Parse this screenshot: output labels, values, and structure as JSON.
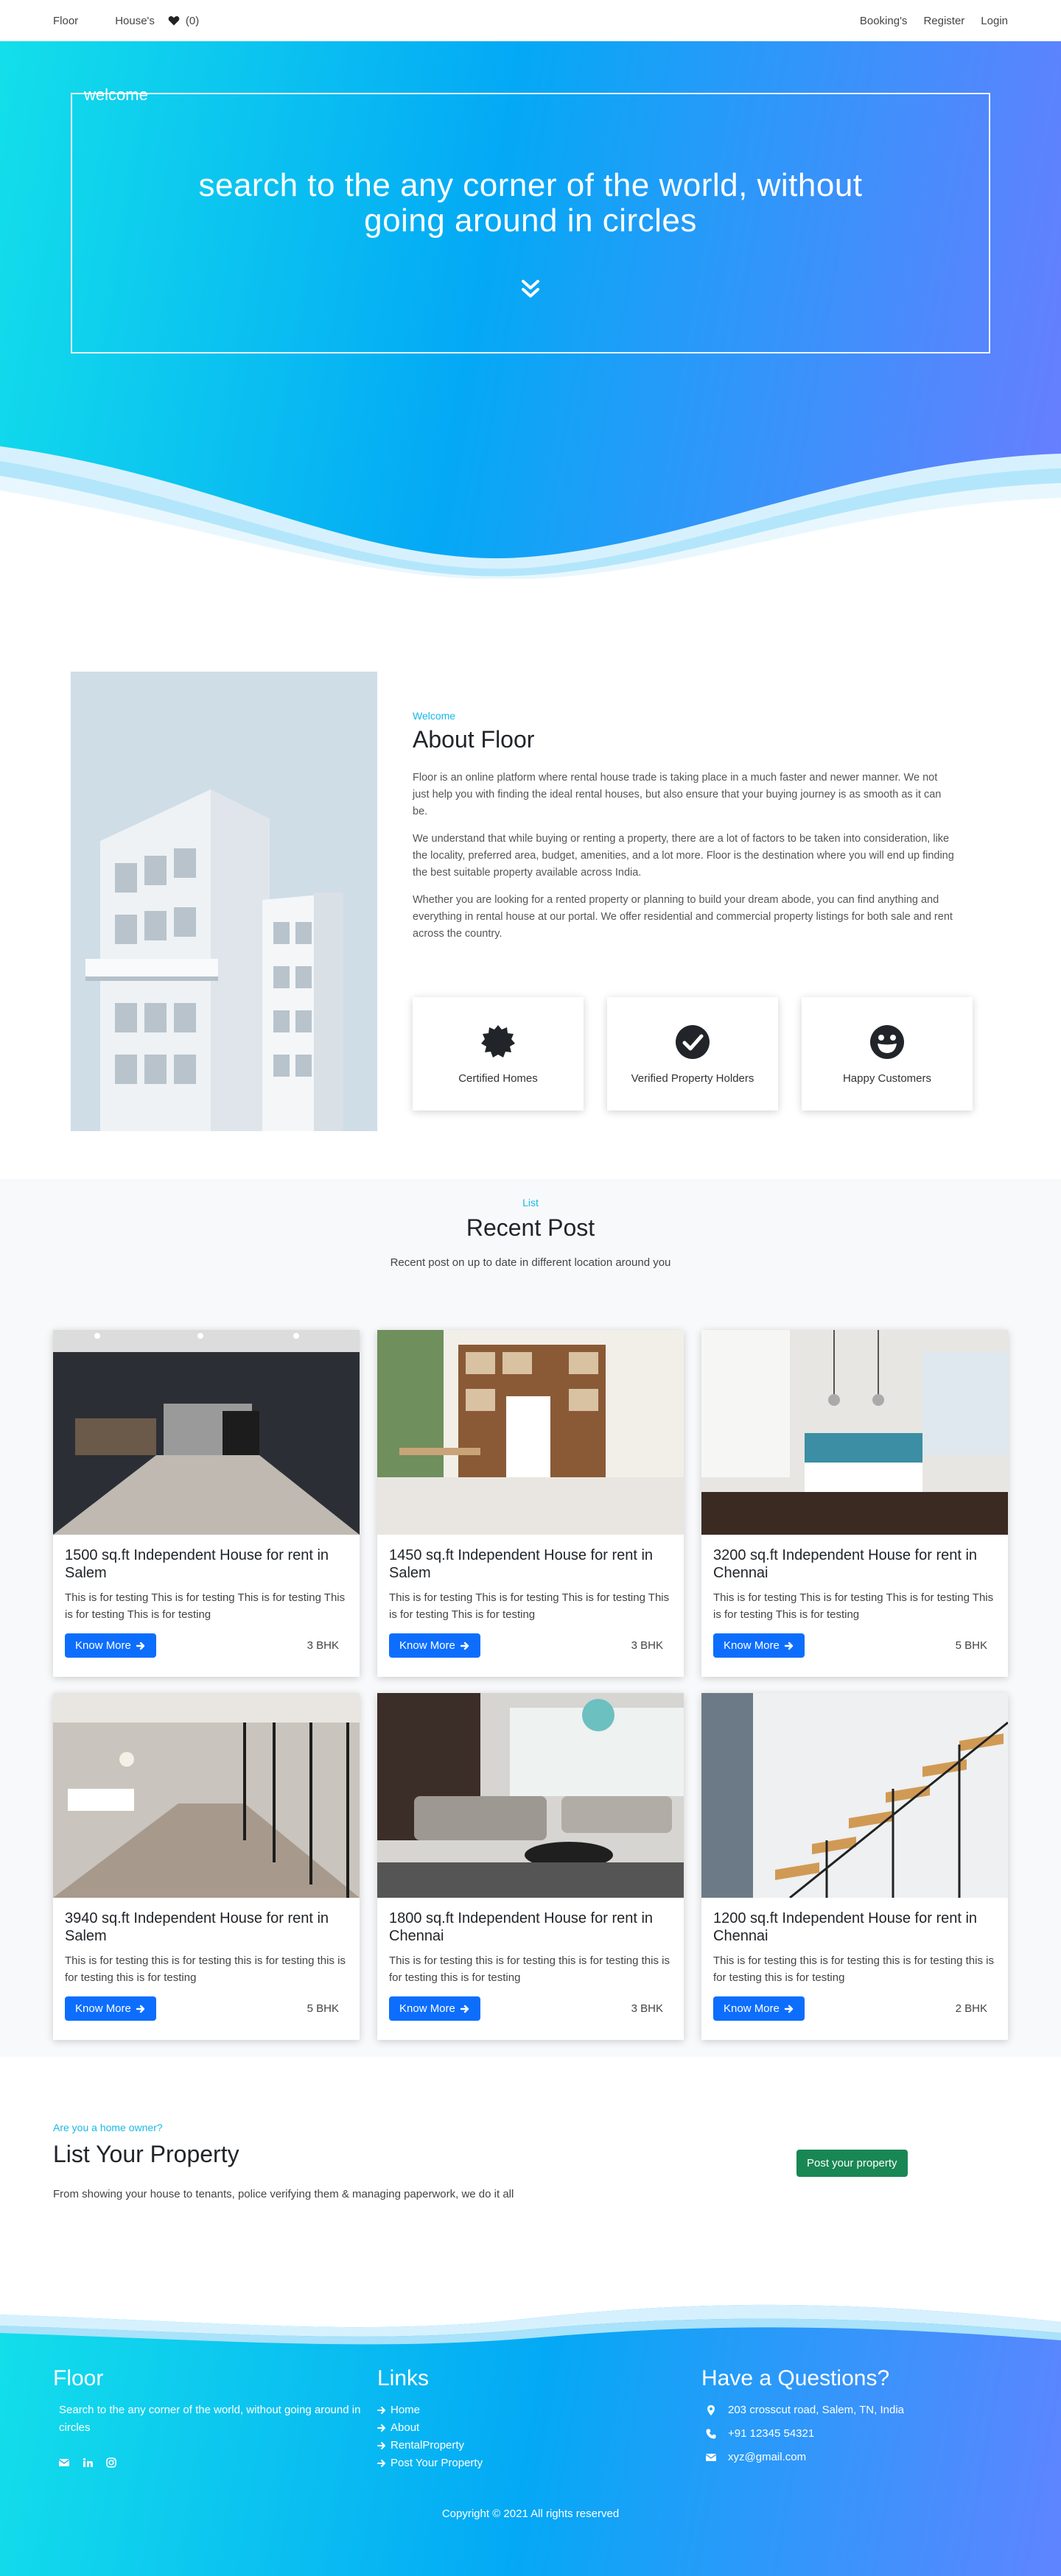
{
  "nav": {
    "brand": "Floor",
    "houses": "House's",
    "fav_count": "(0)",
    "bookings": "Booking's",
    "register": "Register",
    "login": "Login"
  },
  "hero": {
    "legend": "welcome",
    "title": "search to the any corner of the world, without going around in circles"
  },
  "about": {
    "eyebrow": "Welcome",
    "title": "About Floor",
    "p1": "Floor is an online platform where rental house trade is taking place in a much faster and newer manner. We not just help you with finding the ideal rental houses, but also ensure that your buying journey is as smooth as it can be.",
    "p2": "We understand that while buying or renting a property, there are a lot of factors to be taken into consideration, like the locality, preferred area, budget, amenities, and a lot more. Floor is the destination where you will end up finding the best suitable property available across India.",
    "p3": "Whether you are looking for a rented property or planning to build your dream abode, you can find anything and everything in rental house at our portal. We offer residential and commercial property listings for both sale and rent across the country.",
    "features": [
      {
        "label": "Certified Homes",
        "icon": "certificate-icon"
      },
      {
        "label": "Verified Property Holders",
        "icon": "check-circle-icon"
      },
      {
        "label": "Happy Customers",
        "icon": "grin-icon"
      }
    ]
  },
  "recent": {
    "eyebrow": "List",
    "title": "Recent Post",
    "subtitle": "Recent post on up to date in different location around you",
    "button_label": "Know More",
    "cards": [
      {
        "title": "1500 sq.ft Independent House for rent in Salem",
        "text": "This is for testing This is for testing This is for testing This is for testing This is for testing",
        "bhk": "3 BHK"
      },
      {
        "title": "1450 sq.ft Independent House for rent in Salem",
        "text": "This is for testing This is for testing This is for testing This is for testing This is for testing",
        "bhk": "3 BHK"
      },
      {
        "title": "3200 sq.ft Independent House for rent in Chennai",
        "text": "This is for testing This is for testing This is for testing This is for testing This is for testing",
        "bhk": "5 BHK"
      },
      {
        "title": "3940 sq.ft Independent House for rent in Salem",
        "text": "This is for testing this is for testing this is for testing this is for testing this is for testing",
        "bhk": "5 BHK"
      },
      {
        "title": "1800 sq.ft Independent House for rent in Chennai",
        "text": "This is for testing this is for testing this is for testing this is for testing this is for testing",
        "bhk": "3 BHK"
      },
      {
        "title": "1200 sq.ft Independent House for rent in Chennai",
        "text": "This is for testing this is for testing this is for testing this is for testing this is for testing",
        "bhk": "2 BHK"
      }
    ]
  },
  "list_property": {
    "eyebrow": "Are you a home owner?",
    "title": "List Your Property",
    "text": "From showing your house to tenants, police verifying them & managing paperwork, we do it all",
    "button": "Post your property"
  },
  "footer": {
    "brand": "Floor",
    "desc": "Search to the any corner of the world, without going around in circles",
    "links_title": "Links",
    "links": [
      "Home",
      "About",
      "RentalProperty",
      "Post Your Property"
    ],
    "contact_title": "Have a Questions?",
    "address": "203 crosscut road, Salem, TN, India",
    "phone": "+91 12345 54321",
    "email": "xyz@gmail.com",
    "copyright": "Copyright © 2021 All rights reserved"
  },
  "colors": {
    "brand": "#2e7ff0",
    "accent": "#17b8e6",
    "primary_button": "#0d6efd",
    "success_button": "#198754"
  }
}
